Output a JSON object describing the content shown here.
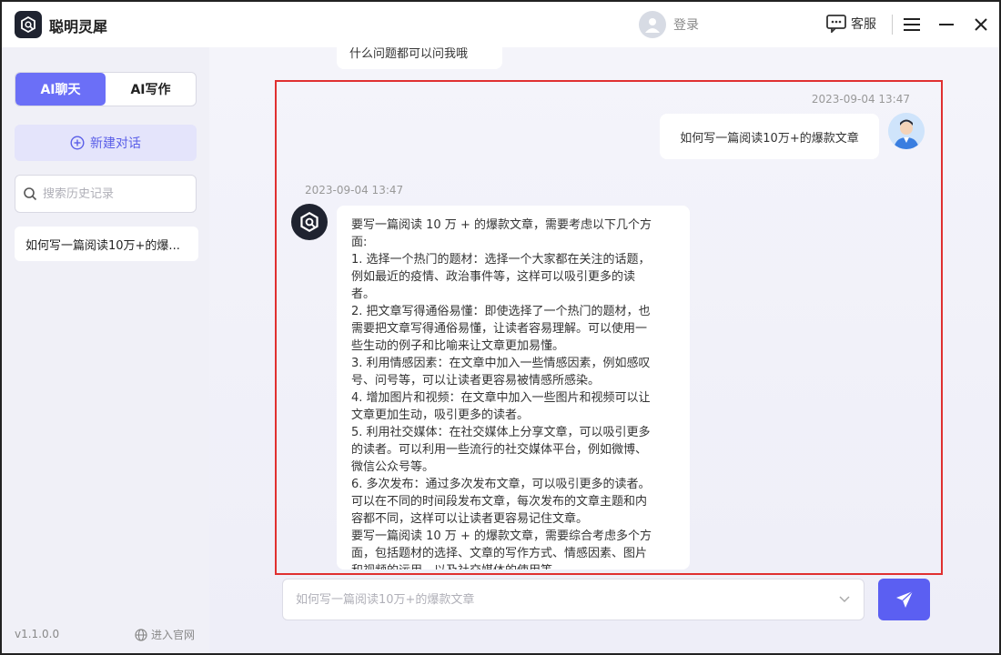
{
  "app": {
    "title": "聪明灵犀"
  },
  "header": {
    "login_label": "登录",
    "service_label": "客服"
  },
  "sidebar": {
    "tabs": [
      {
        "label": "AI聊天",
        "active": true
      },
      {
        "label": "AI写作",
        "active": false
      }
    ],
    "new_chat_label": "新建对话",
    "search_placeholder": "搜索历史记录",
    "history": [
      "如何写一篇阅读10万+的爆..."
    ],
    "version": "v1.1.0.0",
    "website_label": "进入官网"
  },
  "chat": {
    "previous_snippet": "什么问题都可以问我哦",
    "user_message": {
      "timestamp": "2023-09-04 13:47",
      "text": "如何写一篇阅读10万+的爆款文章"
    },
    "bot_message": {
      "timestamp": "2023-09-04 13:47",
      "lines": [
        "要写一篇阅读 10 万 + 的爆款文章，需要考虑以下几个方",
        "面:",
        "1. 选择一个热门的题材：选择一个大家都在关注的话题，",
        "例如最近的疫情、政治事件等，这样可以吸引更多的读",
        "者。",
        "2. 把文章写得通俗易懂：即使选择了一个热门的题材，也",
        "需要把文章写得通俗易懂，让读者容易理解。可以使用一",
        "些生动的例子和比喻来让文章更加易懂。",
        "3. 利用情感因素：在文章中加入一些情感因素，例如感叹",
        "号、问号等，可以让读者更容易被情感所感染。",
        "4. 增加图片和视频：在文章中加入一些图片和视频可以让",
        "文章更加生动，吸引更多的读者。",
        "5. 利用社交媒体：在社交媒体上分享文章，可以吸引更多",
        "的读者。可以利用一些流行的社交媒体平台，例如微博、",
        "微信公众号等。",
        "6. 多次发布：通过多次发布文章，可以吸引更多的读者。",
        "可以在不同的时间段发布文章，每次发布的文章主题和内",
        "容都不同，这样可以让读者更容易记住文章。",
        "要写一篇阅读 10 万 + 的爆款文章，需要综合考虑多个方",
        "面，包括题材的选择、文章的写作方式、情感因素、图片",
        "和视频的运用，以及社交媒体的使用等。"
      ]
    }
  },
  "composer": {
    "placeholder": "如何写一篇阅读10万+的爆款文章"
  },
  "colors": {
    "accent": "#5b5ff2",
    "highlight_border": "#e03030"
  }
}
